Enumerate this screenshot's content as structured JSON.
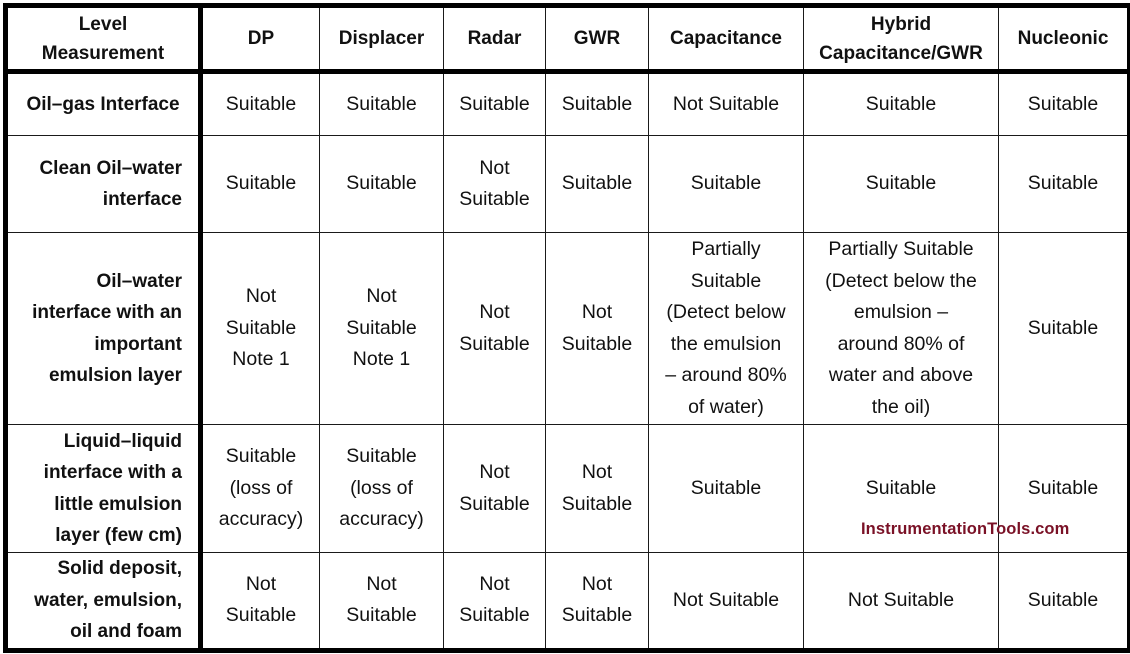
{
  "table": {
    "corner_header": "Level\nMeasurement",
    "columns": [
      "DP",
      "Displacer",
      "Radar",
      "GWR",
      "Capacitance",
      "Hybrid\nCapacitance/GWR",
      "Nucleonic"
    ],
    "rows": [
      {
        "label": "Oil–gas Interface",
        "cells": [
          "Suitable",
          "Suitable",
          "Suitable",
          "Suitable",
          "Not Suitable",
          "Suitable",
          "Suitable"
        ]
      },
      {
        "label": "Clean Oil–water\ninterface",
        "cells": [
          "Suitable",
          "Suitable",
          "Not\nSuitable",
          "Suitable",
          "Suitable",
          "Suitable",
          "Suitable"
        ]
      },
      {
        "label": "Oil–water\ninterface with an\nimportant\nemulsion layer",
        "cells": [
          "Not\nSuitable\nNote 1",
          "Not\nSuitable\nNote 1",
          "Not\nSuitable",
          "Not\nSuitable",
          "Partially\nSuitable\n(Detect below\nthe emulsion\n– around 80%\nof water)",
          "Partially Suitable\n(Detect below the\nemulsion –\naround 80% of\nwater and above\nthe oil)",
          "Suitable"
        ]
      },
      {
        "label": "Liquid–liquid\ninterface with a\nlittle emulsion\nlayer (few cm)",
        "cells": [
          "Suitable\n(loss of\naccuracy)",
          "Suitable\n(loss of\naccuracy)",
          "Not\nSuitable",
          "Not\nSuitable",
          "Suitable",
          "Suitable",
          "Suitable"
        ]
      },
      {
        "label": "Solid deposit,\nwater, emulsion,\noil and foam",
        "cells": [
          "Not\nSuitable",
          "Not\nSuitable",
          "Not\nSuitable",
          "Not\nSuitable",
          "Not Suitable",
          "Not Suitable",
          "Suitable"
        ]
      }
    ]
  },
  "watermark": {
    "text": "InstrumentationTools.com",
    "color": "#7a1126"
  }
}
